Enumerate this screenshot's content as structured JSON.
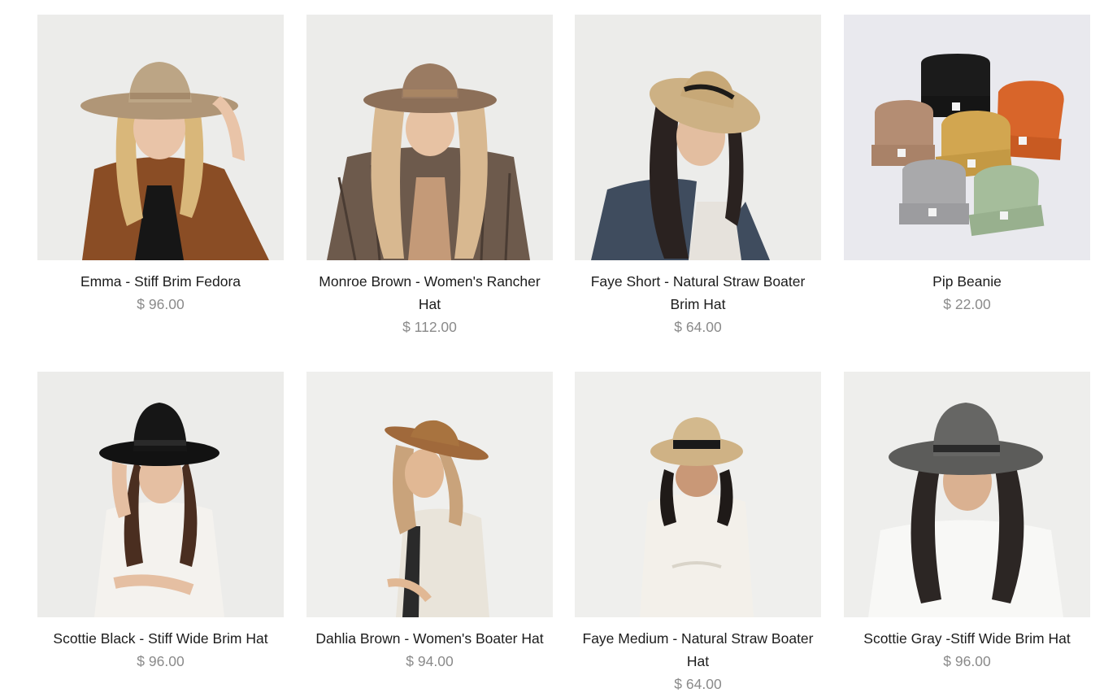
{
  "products": [
    {
      "name": "Emma - Stiff Brim Fedora",
      "price": "$ 96.00",
      "image_icon": "photo-woman-tan-fedora"
    },
    {
      "name": "Monroe Brown - Women's Rancher Hat",
      "price": "$ 112.00",
      "image_icon": "photo-woman-brown-rancher-hat"
    },
    {
      "name": "Faye Short - Natural Straw Boater Brim Hat",
      "price": "$ 64.00",
      "image_icon": "photo-woman-straw-boater"
    },
    {
      "name": "Pip Beanie",
      "price": "$ 22.00",
      "image_icon": "photo-six-beanies"
    },
    {
      "name": "Scottie Black - Stiff Wide Brim Hat",
      "price": "$ 96.00",
      "image_icon": "photo-woman-black-wide-brim"
    },
    {
      "name": "Dahlia Brown - Women's Boater Hat",
      "price": "$ 94.00",
      "image_icon": "photo-woman-brown-boater"
    },
    {
      "name": "Faye Medium - Natural Straw Boater Hat",
      "price": "$ 64.00",
      "image_icon": "photo-woman-straw-boater-medium"
    },
    {
      "name": "Scottie Gray -Stiff Wide Brim Hat",
      "price": "$ 96.00",
      "image_icon": "photo-woman-gray-wide-brim"
    }
  ],
  "colors": {
    "product_name": "#1c1c1c",
    "price": "#8a8a8a",
    "photo_background": "#ececea"
  }
}
